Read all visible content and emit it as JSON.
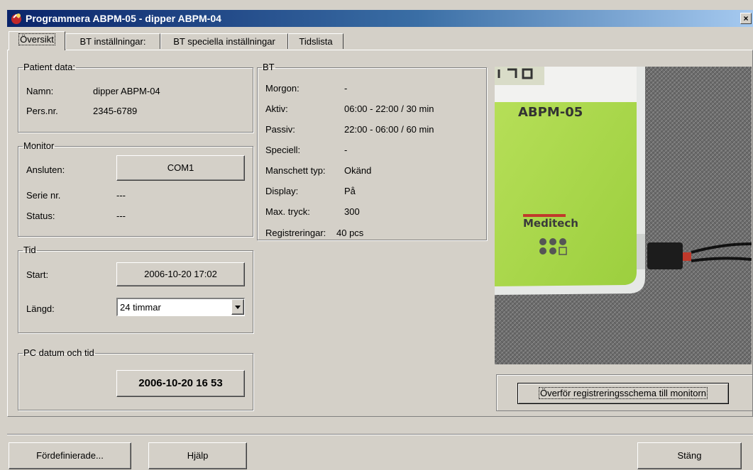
{
  "window": {
    "title": "Programmera ABPM-05 - dipper ABPM-04",
    "close_glyph": "×"
  },
  "tabs": [
    {
      "label": "Översikt",
      "active": true
    },
    {
      "label": "BT inställningar:",
      "active": false
    },
    {
      "label": "BT speciella inställningar",
      "active": false
    },
    {
      "label": "Tidslista",
      "active": false
    }
  ],
  "patient": {
    "legend": "Patient data:",
    "name_label": "Namn:",
    "name_value": "dipper ABPM-04",
    "persnr_label": "Pers.nr.",
    "persnr_value": "2345-6789"
  },
  "monitor": {
    "legend": "Monitor",
    "connected_label": "Ansluten:",
    "connected_value": "COM1",
    "serial_label": "Serie nr.",
    "serial_value": "---",
    "status_label": "Status:",
    "status_value": "---"
  },
  "tid": {
    "legend": "Tid",
    "start_label": "Start:",
    "start_value": "2006-10-20 17:02",
    "length_label": "Längd:",
    "length_value": "24 timmar"
  },
  "pc": {
    "legend": "PC datum och tid",
    "datetime": "2006-10-20 16 53"
  },
  "bt": {
    "legend": "BT",
    "rows": [
      {
        "label": "Morgon:",
        "value": "-"
      },
      {
        "label": "Aktiv:",
        "value": "06:00 - 22:00 / 30 min"
      },
      {
        "label": "Passiv:",
        "value": "22:00 - 06:00 / 60 min"
      },
      {
        "label": "Speciell:",
        "value": "-"
      },
      {
        "label": "Manschett typ:",
        "value": "Okänd"
      },
      {
        "label": "Display:",
        "value": "På"
      },
      {
        "label": "Max. tryck:",
        "value": "300"
      },
      {
        "label": "Registreringar:",
        "value": "40 pcs"
      }
    ]
  },
  "device_photo": {
    "model_label": "ABPM-05",
    "brand_label": "Meditech"
  },
  "transfer_button": "Överför registreringsschema till monitorn",
  "footer": {
    "predefined": "Fördefinierade...",
    "help": "Hjälp",
    "close": "Stäng"
  }
}
